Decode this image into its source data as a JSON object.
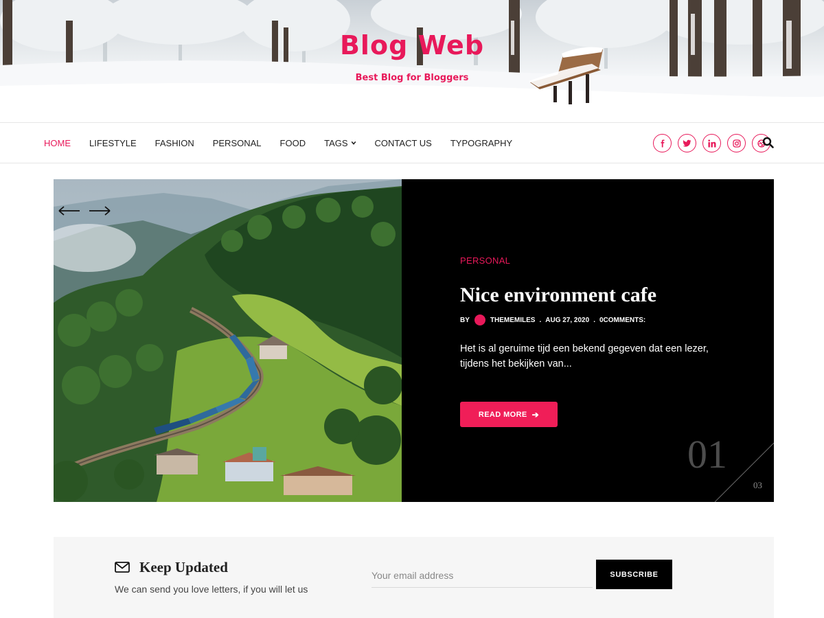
{
  "header": {
    "site_title": "Blog Web",
    "tagline": "Best Blog for Bloggers"
  },
  "nav": {
    "items": [
      {
        "label": "HOME",
        "active": true
      },
      {
        "label": "LIFESTYLE"
      },
      {
        "label": "FASHION"
      },
      {
        "label": "PERSONAL"
      },
      {
        "label": "FOOD"
      },
      {
        "label": "TAGS",
        "has_dropdown": true
      },
      {
        "label": "CONTACT US"
      },
      {
        "label": "TYPOGRAPHY"
      }
    ],
    "social_icons": [
      "facebook-icon",
      "twitter-icon",
      "linkedin-icon",
      "instagram-icon",
      "dribbble-icon"
    ],
    "search_icon": "search-icon"
  },
  "slider": {
    "category": "PERSONAL",
    "title": "Nice environment cafe",
    "meta": {
      "by": "BY",
      "author": "THEMEMILES",
      "date": "AUG 27, 2020",
      "comments": "0COMMENTS:"
    },
    "excerpt": "Het is al geruime tijd een bekend gegeven dat een lezer, tijdens het bekijken van...",
    "read_more": "READ MORE",
    "current": "01",
    "total": "03"
  },
  "newsletter": {
    "title": "Keep Updated",
    "description": "We can send you love letters, if you will let us",
    "input_placeholder": "Your email address",
    "submit_label": "SUBSCRIBE"
  },
  "colors": {
    "accent": "#e8195a",
    "dark": "#000000",
    "newsletter_bg": "#f6f6f6"
  }
}
